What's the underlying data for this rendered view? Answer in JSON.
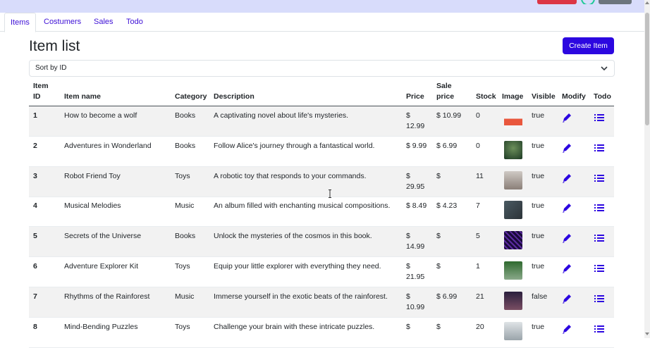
{
  "nav": {
    "tabs": [
      {
        "label": "Items"
      },
      {
        "label": "Costumers"
      },
      {
        "label": "Sales"
      },
      {
        "label": "Todo"
      }
    ]
  },
  "page": {
    "title": "Item list",
    "create_button": "Create Item",
    "sort_selected": "Sort by ID"
  },
  "table": {
    "headers": {
      "id_line1": "Item",
      "id_line2": "ID",
      "name": "Item name",
      "category": "Category",
      "description": "Description",
      "price": "Price",
      "sale_line1": "Sale",
      "sale_line2": "price",
      "stock": "Stock",
      "image": "Image",
      "visible": "Visible",
      "modify": "Modify",
      "todo": "Todo"
    },
    "rows": [
      {
        "id": "1",
        "name": "How to become a wolf",
        "category": "Books",
        "description": "A captivating novel about life's mysteries.",
        "price_a": "$",
        "price_b": "12.99",
        "sale_a": "$ 10.99",
        "sale_b": "",
        "stock": "0",
        "visible": "true"
      },
      {
        "id": "2",
        "name": "Adventures in Wonderland",
        "category": "Books",
        "description": "Follow Alice's journey through a fantastical world.",
        "price_a": "$ 9.99",
        "price_b": "",
        "sale_a": "$ 6.99",
        "sale_b": "",
        "stock": "0",
        "visible": "true"
      },
      {
        "id": "3",
        "name": "Robot Friend Toy",
        "category": "Toys",
        "description": "A robotic toy that responds to your commands.",
        "price_a": "$",
        "price_b": "29.95",
        "sale_a": "$",
        "sale_b": "",
        "stock": "11",
        "visible": "true"
      },
      {
        "id": "4",
        "name": "Musical Melodies",
        "category": "Music",
        "description": "An album filled with enchanting musical compositions.",
        "price_a": "$ 8.49",
        "price_b": "",
        "sale_a": "$ 4.23",
        "sale_b": "",
        "stock": "7",
        "visible": "true"
      },
      {
        "id": "5",
        "name": "Secrets of the Universe",
        "category": "Books",
        "description": "Unlock the mysteries of the cosmos in this book.",
        "price_a": "$",
        "price_b": "14.99",
        "sale_a": "$",
        "sale_b": "",
        "stock": "5",
        "visible": "true"
      },
      {
        "id": "6",
        "name": "Adventure Explorer Kit",
        "category": "Toys",
        "description": "Equip your little explorer with everything they need.",
        "price_a": "$",
        "price_b": "21.95",
        "sale_a": "$",
        "sale_b": "",
        "stock": "1",
        "visible": "true"
      },
      {
        "id": "7",
        "name": "Rhythms of the Rainforest",
        "category": "Music",
        "description": "Immerse yourself in the exotic beats of the rainforest.",
        "price_a": "$",
        "price_b": "10.99",
        "sale_a": "$ 6.99",
        "sale_b": "",
        "stock": "21",
        "visible": "false"
      },
      {
        "id": "8",
        "name": "Mind-Bending Puzzles",
        "category": "Toys",
        "description": "Challenge your brain with these intricate puzzles.",
        "price_a": "$",
        "price_b": "",
        "sale_a": "$",
        "sale_b": "",
        "stock": "20",
        "visible": "true"
      }
    ]
  },
  "colors": {
    "accent": "#2c07e0",
    "link": "#3d0fd6",
    "topbar": "#d8dcfb",
    "stripe": "#f2f2f2"
  },
  "icons": {
    "modify": "pencil-icon",
    "todo": "list-icon",
    "sort": "chevron-down-icon"
  }
}
